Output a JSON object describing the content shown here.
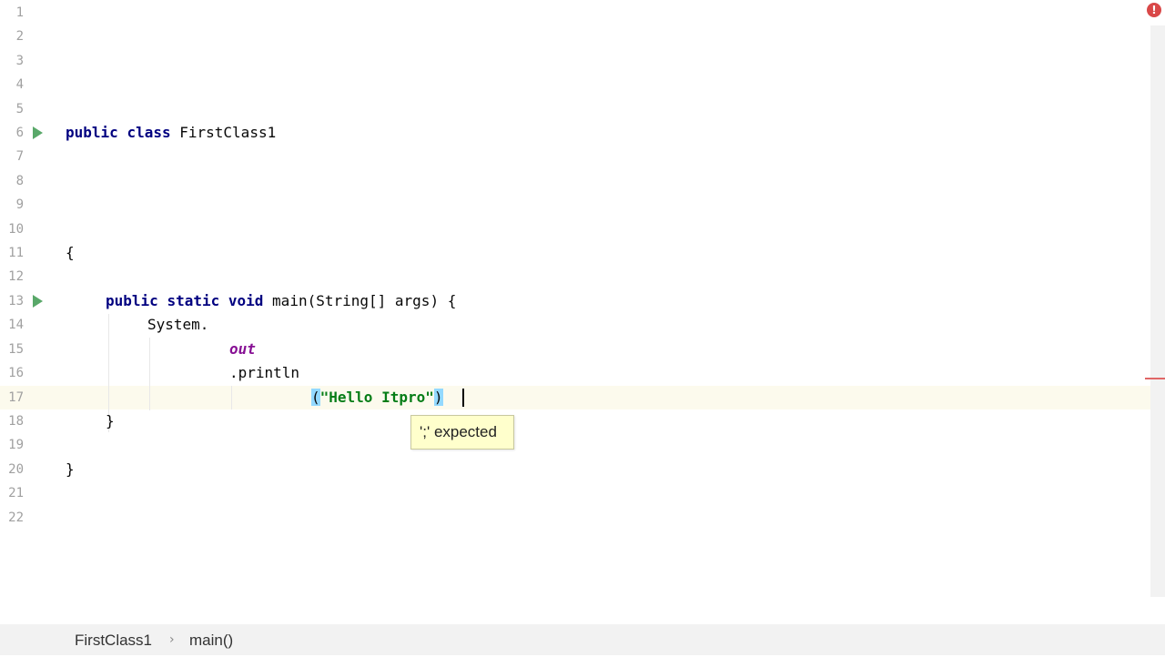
{
  "editor": {
    "line_numbers": [
      "1",
      "2",
      "3",
      "4",
      "5",
      "6",
      "7",
      "8",
      "9",
      "10",
      "11",
      "12",
      "13",
      "14",
      "15",
      "16",
      "17",
      "18",
      "19",
      "20",
      "21",
      "22"
    ],
    "lines": {
      "l6_kw1": "public",
      "l6_kw2": "class",
      "l6_name": "FirstClass1",
      "l11": "{",
      "l13_kw1": "public",
      "l13_kw2": "static",
      "l13_kw3": "void",
      "l13_rest": "main(String[] args) {",
      "l14": "System.",
      "l15": "out",
      "l16": ".println",
      "l17_open": "(",
      "l17_str": "\"Hello Itpro\"",
      "l17_close": ")",
      "l18": "}",
      "l20": "}"
    },
    "tooltip": "';' expected",
    "error_icon": "!",
    "colors": {
      "keyword": "#000080",
      "string": "#067d17",
      "field": "#871094",
      "error": "#d94848"
    }
  },
  "breadcrumbs": {
    "class": "FirstClass1",
    "separator": "›",
    "method": "main()"
  }
}
